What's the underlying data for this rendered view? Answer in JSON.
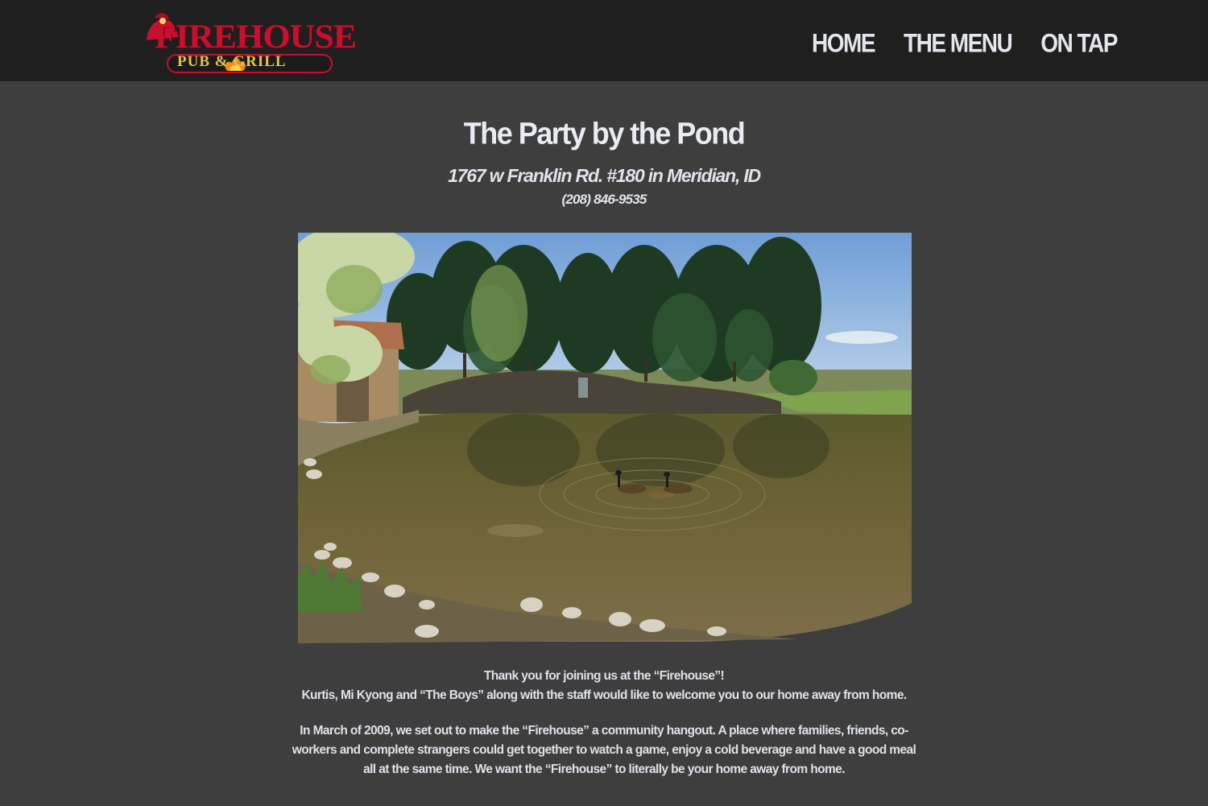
{
  "header": {
    "logo": {
      "name": "FIREHOUSE",
      "sub": "PUB & GRILL",
      "brand_red": "#c8102e",
      "brand_gold": "#e8c14a"
    },
    "nav": [
      {
        "label": "HOME"
      },
      {
        "label": "THE MENU"
      },
      {
        "label": "ON TAP"
      }
    ]
  },
  "main": {
    "title": "The Party by the Pond",
    "address": "1767 w Franklin Rd. #180 in Meridian, ID",
    "phone": "(208) 846-9535",
    "photo": {
      "subject": "pond-with-geese-photo"
    },
    "intro": {
      "line1": "Thank you for joining us at the “Firehouse”!",
      "line2": "Kurtis, Mi Kyong and “The Boys” along with the staff would like to welcome you to our home away from home.",
      "para2": "In March of 2009, we set out to make the “Firehouse” a community hangout. A place where families, friends, co-workers and complete strangers could get together to watch a game, enjoy a cold beverage and have a good meal all at the same time. We want the “Firehouse” to literally be your home away from home."
    }
  },
  "colors": {
    "header_bg": "#1f1f1f",
    "page_bg": "#3e3e3e",
    "text": "#e3e6ec"
  }
}
